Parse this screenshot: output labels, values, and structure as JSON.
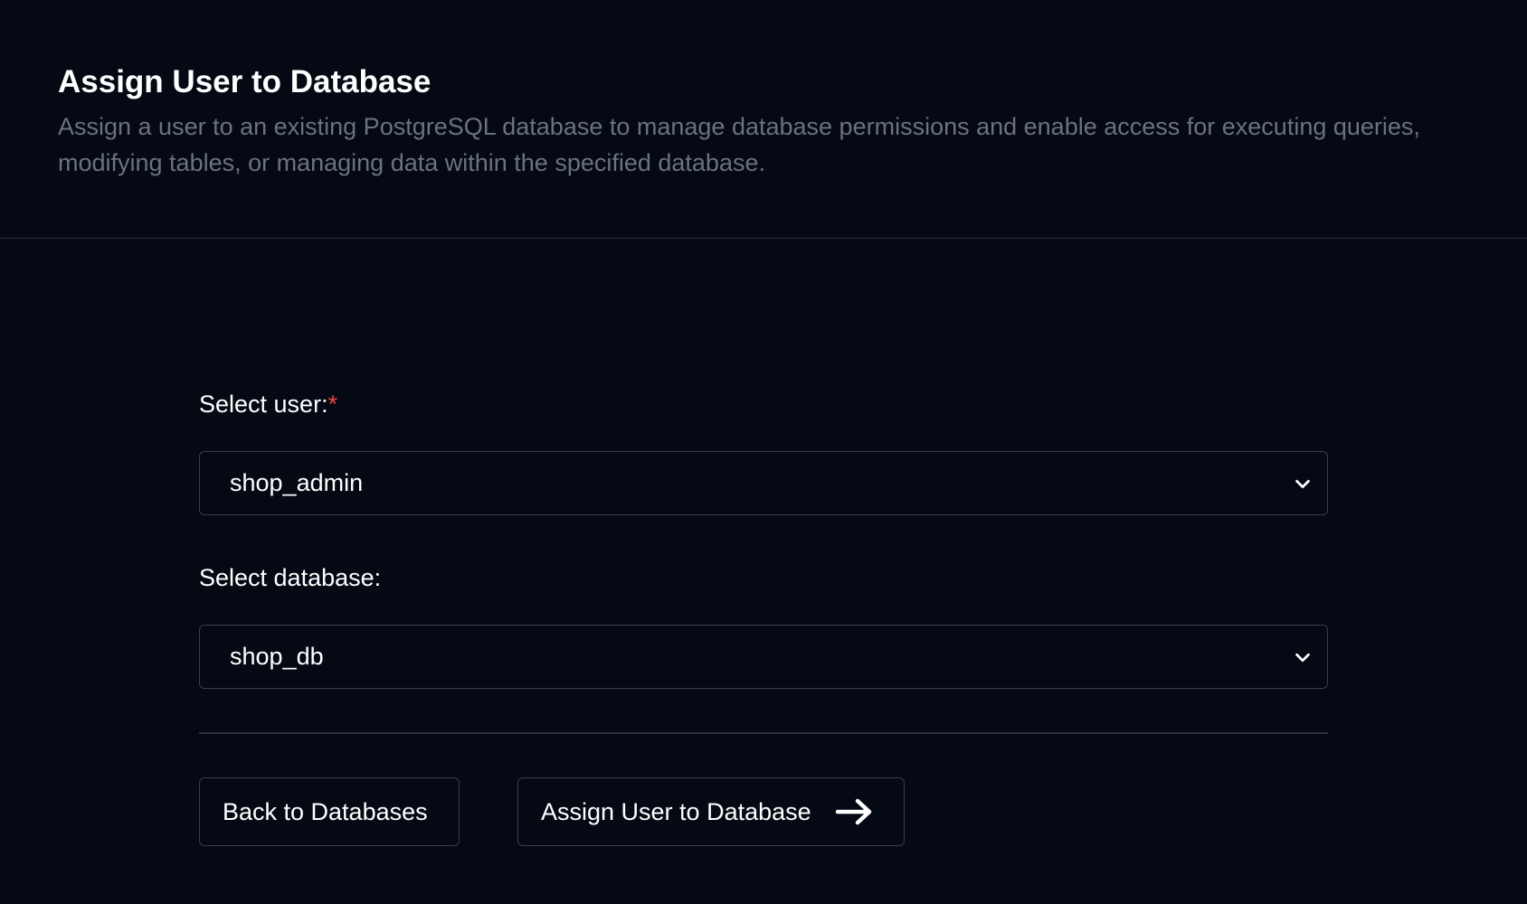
{
  "header": {
    "title": "Assign User to Database",
    "description": "Assign a user to an existing PostgreSQL database to manage database permissions and enable access for executing queries, modifying tables, or managing data within the specified database."
  },
  "form": {
    "user_label": "Select user:",
    "user_required_mark": "*",
    "user_value": "shop_admin",
    "database_label": "Select database:",
    "database_value": "shop_db"
  },
  "actions": {
    "back_label": "Back to Databases",
    "assign_label": "Assign User to Database",
    "assign_icon": "arrow-right-icon",
    "dropdown_icon": "chevron-down-icon"
  },
  "colors": {
    "background": "#050913",
    "description_text": "#6b7280",
    "required": "#ef4444",
    "border": "#3a3f4a"
  }
}
